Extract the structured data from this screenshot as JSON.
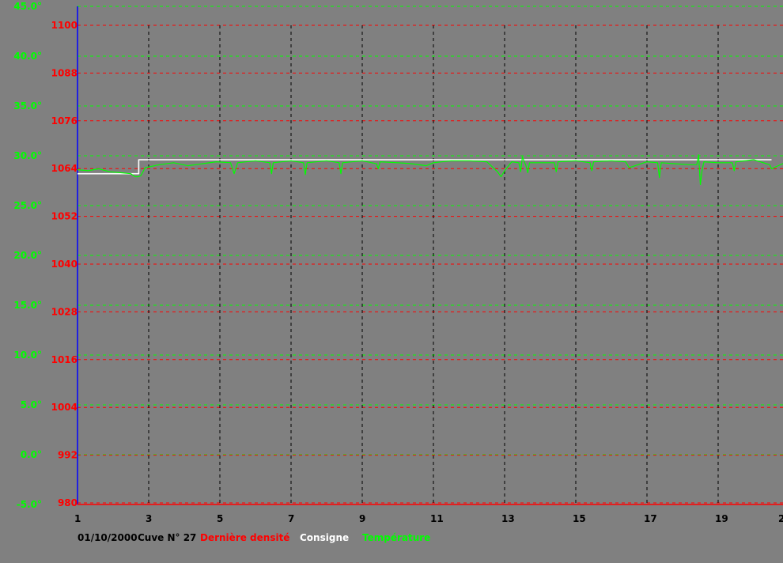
{
  "chart_data": {
    "type": "line",
    "x_ticks": [
      "1",
      "3",
      "5",
      "7",
      "9",
      "11",
      "13",
      "15",
      "17",
      "19",
      "2"
    ],
    "xlim": [
      1,
      21
    ],
    "temperature_axis": {
      "ticks": [
        "45.0°",
        "40.0°",
        "35.0°",
        "30.0°",
        "25.0°",
        "20.0°",
        "15.0°",
        "10.0°",
        "5.0°",
        "0.0°",
        "-5.0°"
      ],
      "ylim": [
        -5,
        45
      ]
    },
    "density_axis": {
      "ticks": [
        "1100",
        "1088",
        "1076",
        "1064",
        "1052",
        "1040",
        "1028",
        "1016",
        "1004",
        "992",
        "980"
      ],
      "ylim": [
        980,
        1100
      ]
    },
    "legend": {
      "date": "01/10/2000",
      "tank": "Cuve N° 27",
      "density": "Dernière densité",
      "setpoint": "Consigne",
      "temperature": "Température"
    },
    "series": [
      {
        "name": "Consigne",
        "color": "#ffffff",
        "x": [
          1.0,
          2.72,
          2.72,
          20.5
        ],
        "y": [
          28.2,
          28.2,
          29.6,
          29.6
        ]
      },
      {
        "name": "Température",
        "color": "#00ff00",
        "x": [
          1.0,
          1.3,
          1.6,
          1.9,
          2.2,
          2.5,
          2.62,
          2.7,
          2.78,
          2.9,
          3.3,
          3.7,
          4.1,
          4.5,
          4.9,
          5.3,
          5.4,
          5.5,
          6.0,
          6.4,
          6.45,
          6.5,
          7.0,
          7.35,
          7.4,
          7.45,
          8.0,
          8.35,
          8.4,
          8.45,
          9.0,
          9.4,
          9.45,
          9.5,
          10.0,
          10.4,
          10.8,
          11.0,
          11.5,
          12.0,
          12.5,
          12.8,
          12.9,
          13.0,
          13.2,
          13.4,
          13.45,
          13.5,
          13.6,
          13.65,
          13.7,
          14.0,
          14.4,
          14.45,
          14.5,
          15.0,
          15.4,
          15.45,
          15.5,
          16.0,
          16.4,
          16.5,
          17.0,
          17.3,
          17.35,
          17.4,
          17.8,
          18.2,
          18.4,
          18.45,
          18.5,
          18.55,
          18.6,
          19.0,
          19.4,
          19.45,
          19.5,
          20.0,
          20.45,
          20.5,
          21.0
        ],
        "y": [
          28.6,
          28.5,
          28.7,
          28.4,
          28.3,
          28.2,
          27.9,
          27.9,
          28.0,
          28.8,
          29.1,
          29.3,
          29.0,
          29.2,
          29.4,
          29.3,
          28.2,
          29.3,
          29.5,
          29.3,
          28.2,
          29.3,
          29.5,
          29.3,
          28.1,
          29.3,
          29.5,
          29.3,
          28.2,
          29.3,
          29.5,
          29.2,
          28.7,
          29.4,
          29.3,
          29.2,
          29.0,
          29.3,
          29.5,
          29.5,
          29.4,
          28.4,
          27.9,
          28.5,
          29.4,
          29.3,
          28.4,
          29.9,
          29.0,
          28.3,
          29.3,
          29.3,
          29.3,
          28.4,
          29.4,
          29.5,
          29.3,
          28.5,
          29.4,
          29.5,
          29.4,
          28.8,
          29.4,
          29.3,
          27.8,
          29.3,
          29.2,
          29.1,
          29.1,
          30.1,
          27.1,
          28.6,
          29.4,
          29.3,
          29.3,
          28.5,
          29.4,
          29.6,
          29.1,
          28.7,
          29.5
        ]
      }
    ]
  }
}
